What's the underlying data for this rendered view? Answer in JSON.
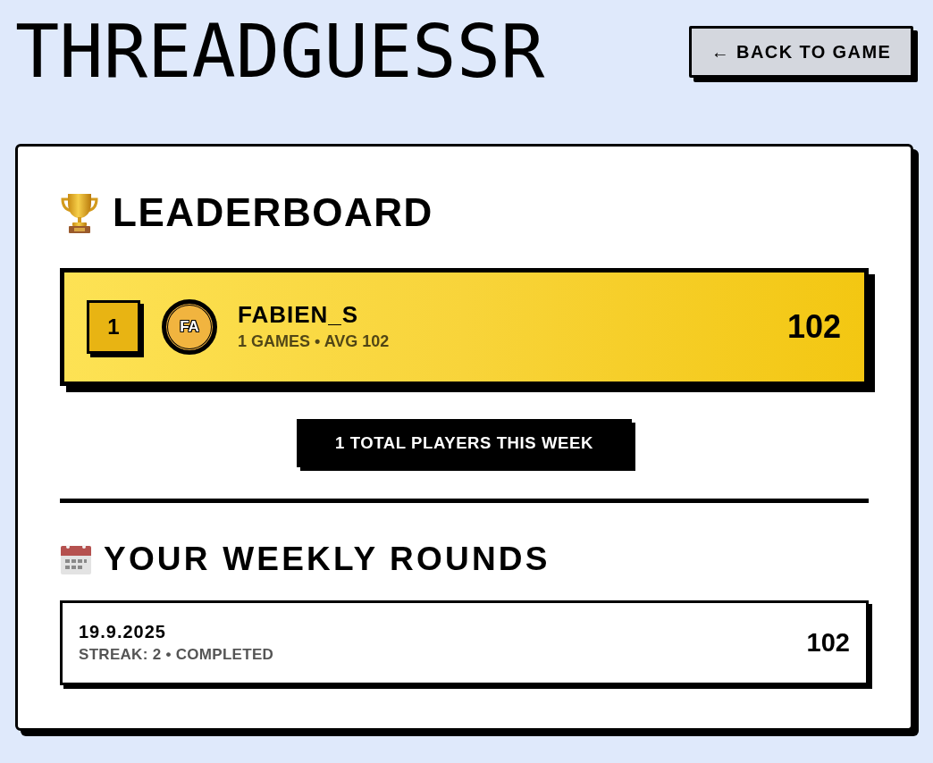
{
  "header": {
    "logo": "THREADGUESSR",
    "back_button": "← BACK TO GAME"
  },
  "leaderboard": {
    "title": "LEADERBOARD",
    "entries": [
      {
        "rank": "1",
        "avatar_initials": "FA",
        "name": "FABIEN_S",
        "stats": "1 GAMES • AVG 102",
        "score": "102"
      }
    ],
    "total_players": "1 TOTAL PLAYERS THIS WEEK"
  },
  "weekly_rounds": {
    "title": "YOUR WEEKLY ROUNDS",
    "rounds": [
      {
        "date": "19.9.2025",
        "details": "STREAK: 2 • COMPLETED",
        "score": "102"
      }
    ]
  }
}
